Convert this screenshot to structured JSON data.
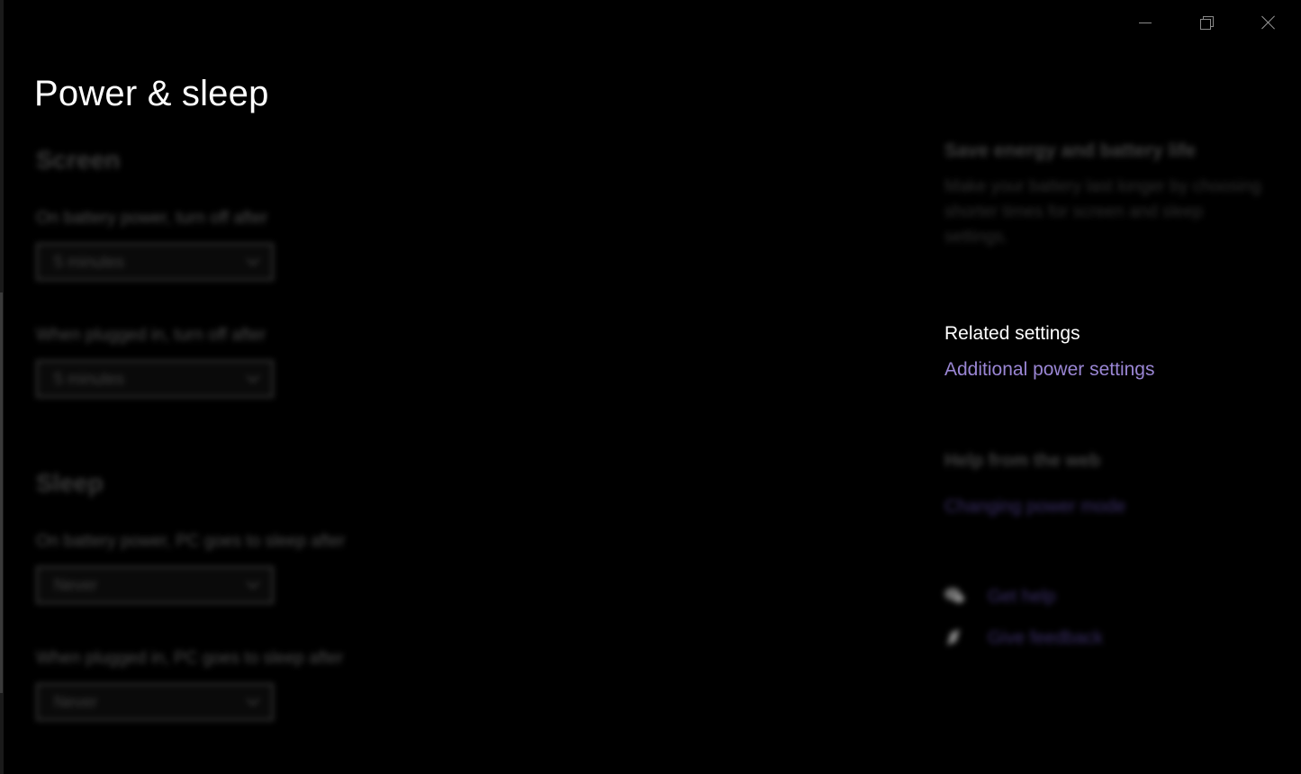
{
  "window": {
    "title": "Power & sleep",
    "caption_buttons": [
      "minimize-icon",
      "restore-icon",
      "close-icon"
    ]
  },
  "screen": {
    "heading": "Screen",
    "battery_label": "On battery power, turn off after",
    "battery_value": "5 minutes",
    "plugged_label": "When plugged in, turn off after",
    "plugged_value": "5 minutes"
  },
  "sleep": {
    "heading": "Sleep",
    "battery_label": "On battery power, PC goes to sleep after",
    "battery_value": "Never",
    "plugged_label": "When plugged in, PC goes to sleep after",
    "plugged_value": "Never"
  },
  "sidebar": {
    "save_heading": "Save energy and battery life",
    "save_text": "Make your battery last longer by choosing shorter times for screen and sleep settings.",
    "related_heading": "Related settings",
    "related_link": "Additional power settings",
    "help_heading": "Help from the web",
    "help_link": "Changing power mode",
    "get_help": "Get help",
    "give_feedback": "Give feedback"
  },
  "colors": {
    "background": "#000000",
    "accent_link": "#9a86d4",
    "text": "#ffffff"
  }
}
